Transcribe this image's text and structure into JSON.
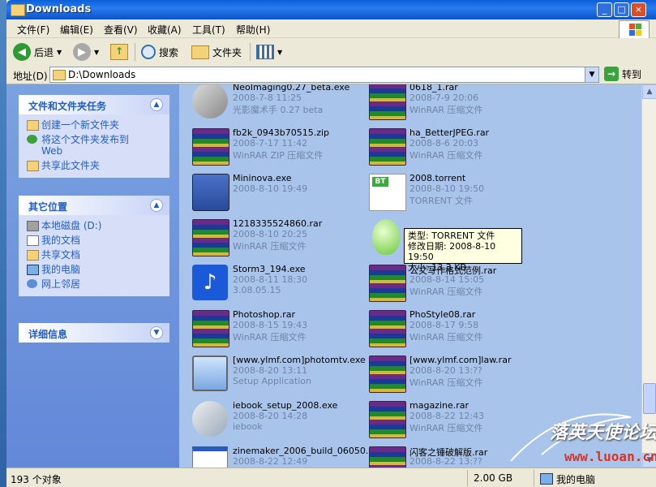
{
  "window": {
    "title": "Downloads"
  },
  "menu": [
    "文件(F)",
    "编辑(E)",
    "查看(V)",
    "收藏(A)",
    "工具(T)",
    "帮助(H)"
  ],
  "toolbar": {
    "back": "后退",
    "search": "搜索",
    "folders": "文件夹"
  },
  "address": {
    "label": "地址(D)",
    "value": "D:\\Downloads",
    "go": "转到"
  },
  "taskpane": {
    "file_tasks": {
      "title": "文件和文件夹任务",
      "items": [
        "创建一个新文件夹",
        "将这个文件夹发布到",
        "Web",
        "共享此文件夹"
      ]
    },
    "other_places": {
      "title": "其它位置",
      "items": [
        "本地磁盘 (D:)",
        "我的文档",
        "共享文档",
        "我的电脑",
        "网上邻居"
      ]
    },
    "details": {
      "title": "详细信息"
    }
  },
  "files": [
    {
      "name": "NeoImaging0.27_beta.exe",
      "date": "2008-7-8 11:25",
      "desc": "光影魔术手 0.27 beta",
      "icon": "setup-cd"
    },
    {
      "name": "0618_1.rar",
      "date": "2008-7-9 20:06",
      "desc": "WinRAR 压缩文件",
      "icon": "winrar"
    },
    {
      "name": "fb2k_0943b70515.zip",
      "date": "2008-7-17 11:42",
      "desc": "WinRAR ZIP 压缩文件",
      "icon": "winrar"
    },
    {
      "name": "ha_BetterJPEG.rar",
      "date": "2008-8-6 20:03",
      "desc": "WinRAR 压缩文件",
      "icon": "winrar"
    },
    {
      "name": "Mininova.exe",
      "date": "2008-8-10 19:49",
      "desc": "",
      "icon": "installer"
    },
    {
      "name": "2008.torrent",
      "date": "2008-8-10 19:50",
      "desc": "TORRENT 文件",
      "icon": "bittorrent"
    },
    {
      "name": "1218335524860.rar",
      "date": "2008-8-10 20:25",
      "desc": "WinRAR 压缩文件",
      "icon": "winrar"
    },
    {
      "name": "",
      "date": "",
      "desc": "",
      "icon": "egg"
    },
    {
      "name": "Storm3_194.exe",
      "date": "2008-8-11 18:30",
      "desc": "3.08.05.15",
      "icon": "storm"
    },
    {
      "name": "公文写作格式范例.rar",
      "date": "2008-8-14 15:05",
      "desc": "WinRAR 压缩文件",
      "icon": "winrar"
    },
    {
      "name": "Photoshop.rar",
      "date": "2008-8-15 19:43",
      "desc": "WinRAR 压缩文件",
      "icon": "winrar"
    },
    {
      "name": "PhoStyle08.rar",
      "date": "2008-8-17 9:58",
      "desc": "WinRAR 压缩文件",
      "icon": "winrar"
    },
    {
      "name": "[www.ylmf.com]photomtv.exe",
      "date": "2008-8-20 13:11",
      "desc": "Setup Application",
      "icon": "monitor-cd"
    },
    {
      "name": "[www.ylmf.com]law.rar",
      "date": "2008-8-20 13:??",
      "desc": "WinRAR 压缩文件",
      "icon": "winrar"
    },
    {
      "name": "iebook_setup_2008.exe",
      "date": "2008-8-20 14:28",
      "desc": "iebook",
      "icon": "setup-cd"
    },
    {
      "name": "magazine.rar",
      "date": "2008-8-22 12:43",
      "desc": "WinRAR 压缩文件",
      "icon": "winrar"
    },
    {
      "name": "zinemaker_2006_build_06050...",
      "date": "2008-8-22 12:49",
      "desc": "",
      "icon": "window-app"
    },
    {
      "name": "闪客之锤破解版.rar",
      "date": "2008-8-22 13:??",
      "desc": "",
      "icon": "winrar"
    }
  ],
  "tooltip": {
    "type": "类型: TORRENT 文件",
    "modified": "修改日期: 2008-8-10 19:50",
    "size": "大小: 13.3 KB"
  },
  "status": {
    "objects": "193 个对象",
    "size": "2.00 GB",
    "location": "我的电脑"
  },
  "watermark": {
    "text": "落英天使论坛",
    "url": "www.luoan.cn"
  }
}
